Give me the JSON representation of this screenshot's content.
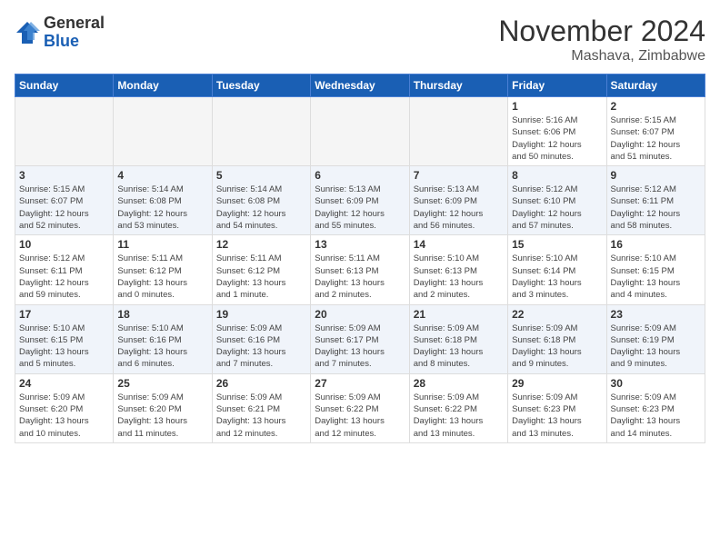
{
  "header": {
    "logo_general": "General",
    "logo_blue": "Blue",
    "month_year": "November 2024",
    "location": "Mashava, Zimbabwe"
  },
  "weekdays": [
    "Sunday",
    "Monday",
    "Tuesday",
    "Wednesday",
    "Thursday",
    "Friday",
    "Saturday"
  ],
  "weeks": [
    [
      {
        "day": "",
        "info": ""
      },
      {
        "day": "",
        "info": ""
      },
      {
        "day": "",
        "info": ""
      },
      {
        "day": "",
        "info": ""
      },
      {
        "day": "",
        "info": ""
      },
      {
        "day": "1",
        "info": "Sunrise: 5:16 AM\nSunset: 6:06 PM\nDaylight: 12 hours\nand 50 minutes."
      },
      {
        "day": "2",
        "info": "Sunrise: 5:15 AM\nSunset: 6:07 PM\nDaylight: 12 hours\nand 51 minutes."
      }
    ],
    [
      {
        "day": "3",
        "info": "Sunrise: 5:15 AM\nSunset: 6:07 PM\nDaylight: 12 hours\nand 52 minutes."
      },
      {
        "day": "4",
        "info": "Sunrise: 5:14 AM\nSunset: 6:08 PM\nDaylight: 12 hours\nand 53 minutes."
      },
      {
        "day": "5",
        "info": "Sunrise: 5:14 AM\nSunset: 6:08 PM\nDaylight: 12 hours\nand 54 minutes."
      },
      {
        "day": "6",
        "info": "Sunrise: 5:13 AM\nSunset: 6:09 PM\nDaylight: 12 hours\nand 55 minutes."
      },
      {
        "day": "7",
        "info": "Sunrise: 5:13 AM\nSunset: 6:09 PM\nDaylight: 12 hours\nand 56 minutes."
      },
      {
        "day": "8",
        "info": "Sunrise: 5:12 AM\nSunset: 6:10 PM\nDaylight: 12 hours\nand 57 minutes."
      },
      {
        "day": "9",
        "info": "Sunrise: 5:12 AM\nSunset: 6:11 PM\nDaylight: 12 hours\nand 58 minutes."
      }
    ],
    [
      {
        "day": "10",
        "info": "Sunrise: 5:12 AM\nSunset: 6:11 PM\nDaylight: 12 hours\nand 59 minutes."
      },
      {
        "day": "11",
        "info": "Sunrise: 5:11 AM\nSunset: 6:12 PM\nDaylight: 13 hours\nand 0 minutes."
      },
      {
        "day": "12",
        "info": "Sunrise: 5:11 AM\nSunset: 6:12 PM\nDaylight: 13 hours\nand 1 minute."
      },
      {
        "day": "13",
        "info": "Sunrise: 5:11 AM\nSunset: 6:13 PM\nDaylight: 13 hours\nand 2 minutes."
      },
      {
        "day": "14",
        "info": "Sunrise: 5:10 AM\nSunset: 6:13 PM\nDaylight: 13 hours\nand 2 minutes."
      },
      {
        "day": "15",
        "info": "Sunrise: 5:10 AM\nSunset: 6:14 PM\nDaylight: 13 hours\nand 3 minutes."
      },
      {
        "day": "16",
        "info": "Sunrise: 5:10 AM\nSunset: 6:15 PM\nDaylight: 13 hours\nand 4 minutes."
      }
    ],
    [
      {
        "day": "17",
        "info": "Sunrise: 5:10 AM\nSunset: 6:15 PM\nDaylight: 13 hours\nand 5 minutes."
      },
      {
        "day": "18",
        "info": "Sunrise: 5:10 AM\nSunset: 6:16 PM\nDaylight: 13 hours\nand 6 minutes."
      },
      {
        "day": "19",
        "info": "Sunrise: 5:09 AM\nSunset: 6:16 PM\nDaylight: 13 hours\nand 7 minutes."
      },
      {
        "day": "20",
        "info": "Sunrise: 5:09 AM\nSunset: 6:17 PM\nDaylight: 13 hours\nand 7 minutes."
      },
      {
        "day": "21",
        "info": "Sunrise: 5:09 AM\nSunset: 6:18 PM\nDaylight: 13 hours\nand 8 minutes."
      },
      {
        "day": "22",
        "info": "Sunrise: 5:09 AM\nSunset: 6:18 PM\nDaylight: 13 hours\nand 9 minutes."
      },
      {
        "day": "23",
        "info": "Sunrise: 5:09 AM\nSunset: 6:19 PM\nDaylight: 13 hours\nand 9 minutes."
      }
    ],
    [
      {
        "day": "24",
        "info": "Sunrise: 5:09 AM\nSunset: 6:20 PM\nDaylight: 13 hours\nand 10 minutes."
      },
      {
        "day": "25",
        "info": "Sunrise: 5:09 AM\nSunset: 6:20 PM\nDaylight: 13 hours\nand 11 minutes."
      },
      {
        "day": "26",
        "info": "Sunrise: 5:09 AM\nSunset: 6:21 PM\nDaylight: 13 hours\nand 12 minutes."
      },
      {
        "day": "27",
        "info": "Sunrise: 5:09 AM\nSunset: 6:22 PM\nDaylight: 13 hours\nand 12 minutes."
      },
      {
        "day": "28",
        "info": "Sunrise: 5:09 AM\nSunset: 6:22 PM\nDaylight: 13 hours\nand 13 minutes."
      },
      {
        "day": "29",
        "info": "Sunrise: 5:09 AM\nSunset: 6:23 PM\nDaylight: 13 hours\nand 13 minutes."
      },
      {
        "day": "30",
        "info": "Sunrise: 5:09 AM\nSunset: 6:23 PM\nDaylight: 13 hours\nand 14 minutes."
      }
    ]
  ]
}
